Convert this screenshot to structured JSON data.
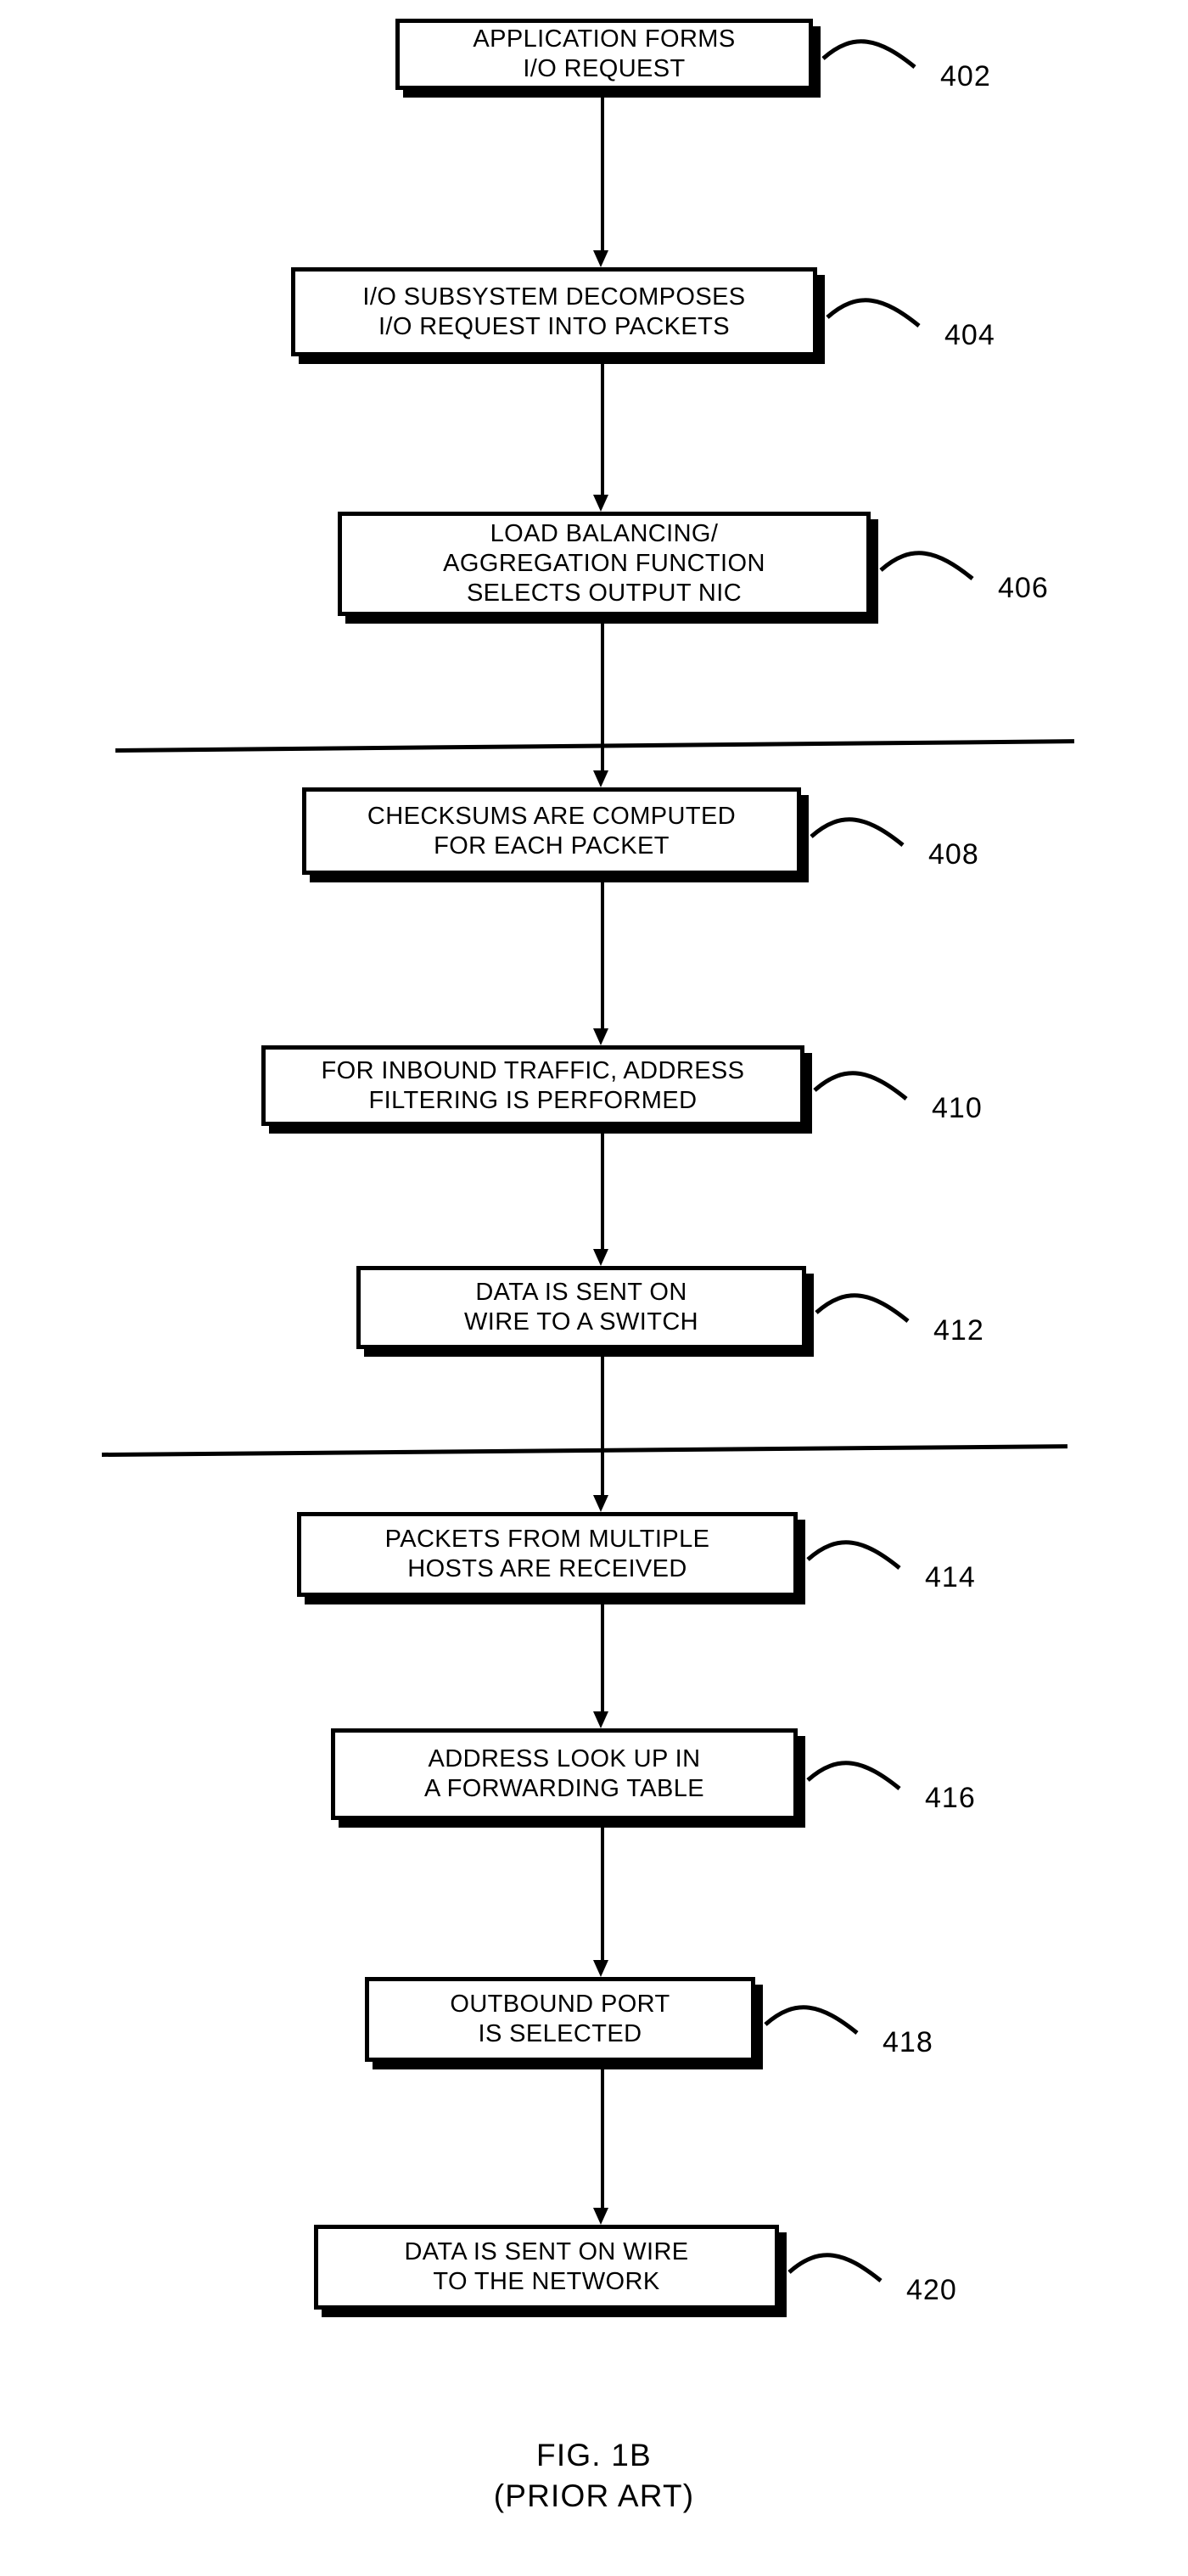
{
  "figure": {
    "caption_line1": "FIG. 1B",
    "caption_line2": "(PRIOR ART)"
  },
  "nodes": [
    {
      "id": "402",
      "ref": "402",
      "text": "APPLICATION FORMS\nI/O REQUEST"
    },
    {
      "id": "404",
      "ref": "404",
      "text": "I/O SUBSYSTEM DECOMPOSES\nI/O REQUEST INTO PACKETS"
    },
    {
      "id": "406",
      "ref": "406",
      "text": "LOAD BALANCING/\nAGGREGATION FUNCTION\nSELECTS OUTPUT NIC"
    },
    {
      "id": "408",
      "ref": "408",
      "text": "CHECKSUMS ARE COMPUTED\nFOR EACH PACKET"
    },
    {
      "id": "410",
      "ref": "410",
      "text": "FOR INBOUND TRAFFIC, ADDRESS\nFILTERING IS PERFORMED"
    },
    {
      "id": "412",
      "ref": "412",
      "text": "DATA IS SENT ON\nWIRE TO A SWITCH"
    },
    {
      "id": "414",
      "ref": "414",
      "text": "PACKETS FROM MULTIPLE\nHOSTS ARE RECEIVED"
    },
    {
      "id": "416",
      "ref": "416",
      "text": "ADDRESS LOOK UP IN\nA FORWARDING TABLE"
    },
    {
      "id": "418",
      "ref": "418",
      "text": "OUTBOUND PORT\nIS SELECTED"
    },
    {
      "id": "420",
      "ref": "420",
      "text": "DATA IS SENT ON WIRE\nTO THE NETWORK"
    }
  ],
  "colors": {
    "ink": "#000000",
    "paper": "#ffffff"
  }
}
